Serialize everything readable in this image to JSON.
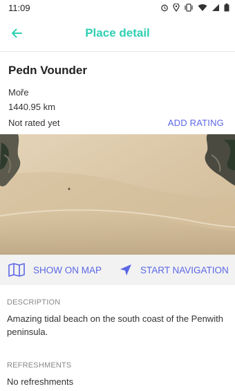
{
  "status_bar": {
    "time": "11:09",
    "icons": [
      "alarm-icon",
      "location-icon",
      "vibrate-icon",
      "wifi-icon",
      "signal-icon",
      "battery-icon"
    ]
  },
  "app_bar": {
    "title": "Place detail",
    "back_icon": "arrow-left-icon",
    "accent_color": "#2fcfb3"
  },
  "place": {
    "name": "Pedn Vounder",
    "region": "Moře",
    "distance": "1440.95 km",
    "rating_status": "Not rated yet",
    "add_rating_label": "ADD RATING"
  },
  "actions": {
    "show_on_map_label": "SHOW ON MAP",
    "show_on_map_icon": "map-icon",
    "start_navigation_label": "START NAVIGATION",
    "start_navigation_icon": "navigation-arrow-icon",
    "action_color": "#5b67e6"
  },
  "sections": {
    "description": {
      "label": "DESCRIPTION",
      "text": "Amazing tidal beach on the south coast of the Penwith peninsula."
    },
    "refreshments": {
      "label": "REFRESHMENTS",
      "text": "No refreshments"
    }
  }
}
